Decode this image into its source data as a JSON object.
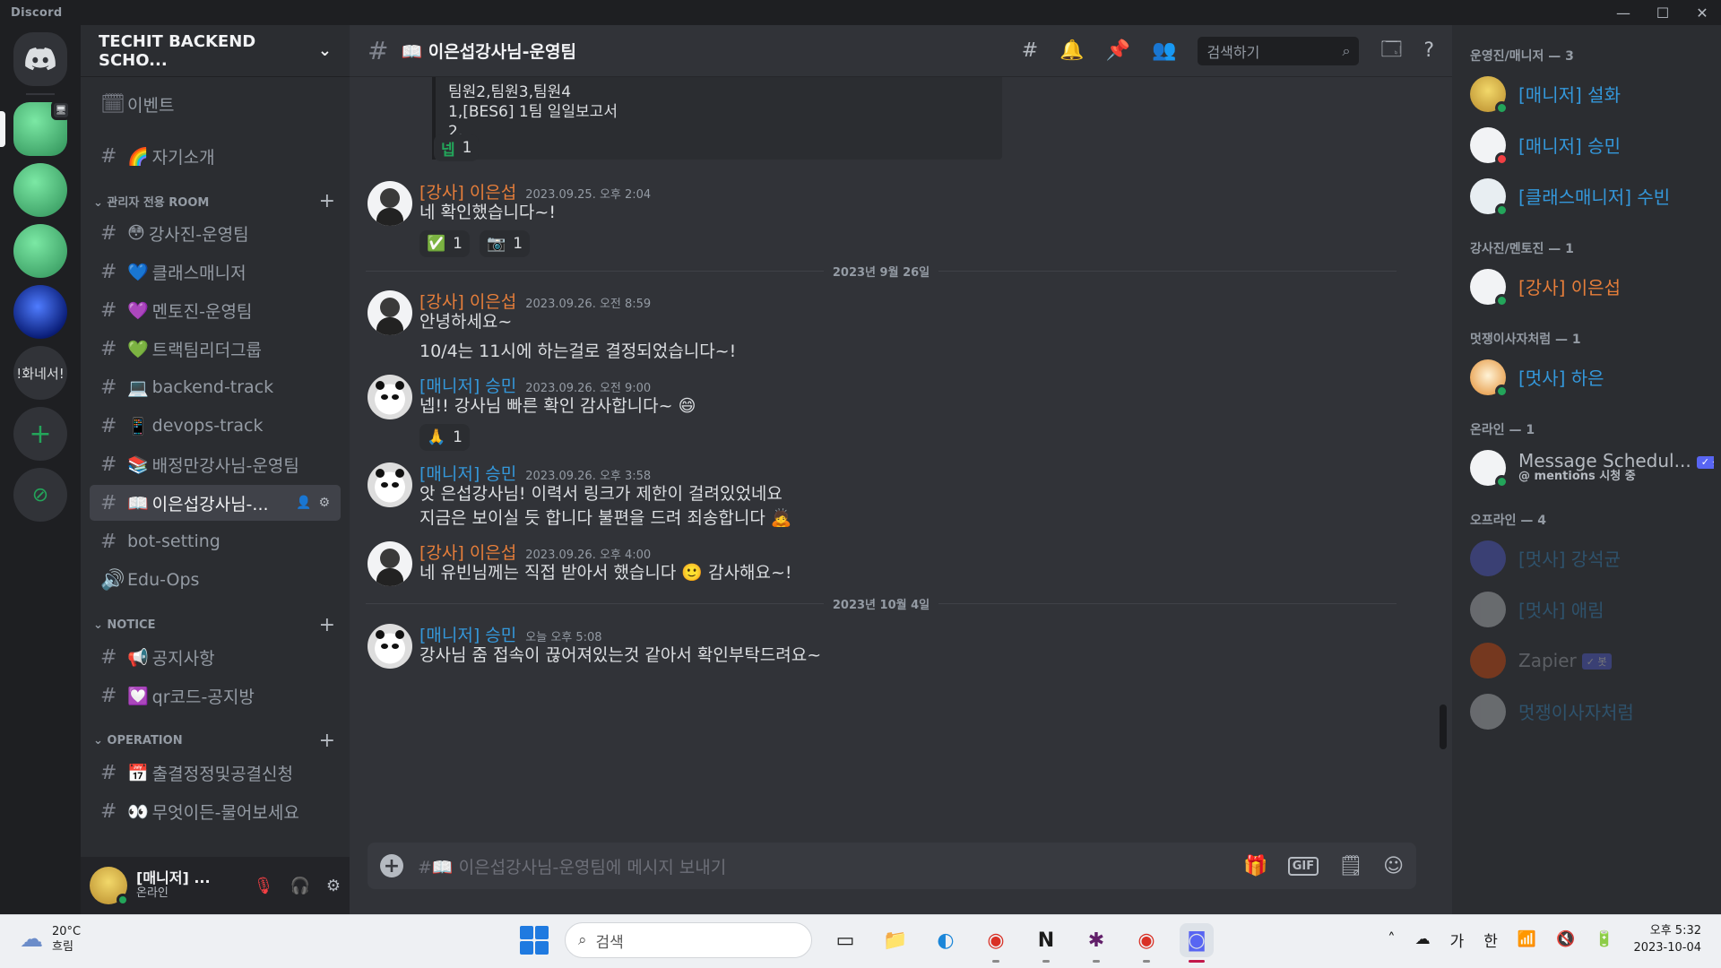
{
  "window": {
    "app_name": "Discord",
    "controls": [
      "—",
      "☐",
      "✕"
    ]
  },
  "servers": [
    {
      "label": "Discord",
      "kind": "home"
    },
    {
      "label": "",
      "kind": "green",
      "active": true,
      "badge": "🖥"
    },
    {
      "label": "",
      "kind": "green"
    },
    {
      "label": "",
      "kind": "green"
    },
    {
      "label": "",
      "kind": "blue"
    },
    {
      "label": "!화네서!"
    },
    {
      "label": "+",
      "kind": "plus"
    },
    {
      "label": "⊘",
      "kind": "compass"
    }
  ],
  "guild": {
    "name": "TECHIT BACKEND SCHO...",
    "chevron": "⌄"
  },
  "sidebar": {
    "events_label": "이벤트",
    "intro_channel": {
      "emoji": "🌈",
      "name": "자기소개"
    },
    "categories": [
      {
        "name": "관리자 전용 ROOM",
        "channels": [
          {
            "emoji": "😳",
            "name": "강사진-운영팀"
          },
          {
            "emoji": "💙",
            "name": "클래스매니저"
          },
          {
            "emoji": "💜",
            "name": "멘토진-운영팀"
          },
          {
            "emoji": "💚",
            "name": "트랙팀리더그룹"
          },
          {
            "emoji": "💻",
            "name": "backend-track"
          },
          {
            "emoji": "📱",
            "name": "devops-track"
          },
          {
            "emoji": "📚",
            "name": "배정만강사님-운영팀"
          },
          {
            "emoji": "📖",
            "name": "이은섭강사님-...",
            "active": true
          },
          {
            "emoji": "",
            "name": "bot-setting"
          },
          {
            "emoji": "",
            "name": "Edu-Ops",
            "voice": true
          }
        ]
      },
      {
        "name": "NOTICE",
        "channels": [
          {
            "emoji": "📢",
            "name": "공지사항"
          },
          {
            "emoji": "💟",
            "name": "qr코드-공지방"
          }
        ]
      },
      {
        "name": "OPERATION",
        "channels": [
          {
            "emoji": "📅",
            "name": "출결정정및공결신청"
          },
          {
            "emoji": "👀",
            "name": "무엇이든-물어보세요"
          }
        ]
      }
    ]
  },
  "user_panel": {
    "name": "[매니저] ...",
    "status": "온라인"
  },
  "header": {
    "channel_title": "📖 이은섭강사님-운영팀",
    "search_placeholder": "검색하기"
  },
  "embed": {
    "lines": [
      "팀원2,팀원3,팀원4",
      "1,[BES6] 1팀 일일보고서",
      "2,"
    ]
  },
  "embed_reactions": [
    {
      "emoji": "넵",
      "count": "1"
    }
  ],
  "messages": [
    {
      "author": "[강사] 이은섭",
      "role": "lecturer",
      "time": "2023.09.25. 오후 2:04",
      "lines": [
        "네 확인했습니다~!"
      ],
      "reactions": [
        {
          "emoji": "✅",
          "count": "1"
        },
        {
          "emoji": "📷",
          "count": "1"
        }
      ]
    },
    {
      "author": "[강사] 이은섭",
      "role": "lecturer",
      "time": "2023.09.26. 오전 8:59",
      "lines": [
        "안녕하세요~",
        "10/4는 11시에 하는걸로 결정되었습니다~!"
      ],
      "reactions": []
    },
    {
      "author": "[매니저] 승민",
      "role": "manager",
      "time": "2023.09.26. 오전 9:00",
      "lines": [
        "넵!! 강사님 빠른 확인 감사합니다~ 😄"
      ],
      "reactions": [
        {
          "emoji": "🙏",
          "count": "1"
        }
      ]
    },
    {
      "author": "[매니저] 승민",
      "role": "manager",
      "time": "2023.09.26. 오후 3:58",
      "lines": [
        "앗 은섭강사님! 이력서 링크가 제한이 걸려있었네요",
        "지금은 보이실 듯 합니다 불편을 드려 죄송합니다 🙇"
      ],
      "reactions": []
    },
    {
      "author": "[강사] 이은섭",
      "role": "lecturer",
      "time": "2023.09.26. 오후 4:00",
      "lines": [
        "네 유빈님께는 직접 받아서 했습니다 🙂 감사해요~!"
      ],
      "reactions": []
    },
    {
      "author": "[매니저] 승민",
      "role": "manager",
      "time": "오늘 오후 5:08",
      "lines": [
        "강사님 줌 접속이 끊어져있는것 같아서 확인부탁드려요~"
      ],
      "reactions": []
    }
  ],
  "dividers": [
    "2023년 9월 26일",
    "2023년 10월 4일"
  ],
  "composer": {
    "placeholder": "#📖 이은섭강사님-운영팀에 메시지 보내기",
    "gif": "GIF"
  },
  "members": {
    "groups": [
      {
        "title": "운영진/매니저 — 3",
        "items": [
          {
            "name": "[매니저] 설화",
            "color": "#3498db",
            "status": "#23a55a"
          },
          {
            "name": "[매니저] 승민",
            "color": "#3498db",
            "status": "#f23f43"
          },
          {
            "name": "[클래스매니저] 수빈",
            "color": "#3498db",
            "status": "#23a55a"
          }
        ]
      },
      {
        "title": "강사진/멘토진 — 1",
        "items": [
          {
            "name": "[강사] 이은섭",
            "color": "#e67e3a",
            "status": "#23a55a"
          }
        ]
      },
      {
        "title": "멋쟁이사자처럼 — 1",
        "items": [
          {
            "name": "[멋사] 하은",
            "color": "#3498db",
            "status": "#23a55a"
          }
        ]
      },
      {
        "title": "온라인 — 1",
        "items": [
          {
            "name": "Message Schedul...",
            "color": "#b5bac1",
            "status": "#23a55a",
            "bot": "✓ 봇",
            "sub": "@ mentions 시청 중"
          }
        ]
      },
      {
        "title": "오프라인 — 4",
        "items": [
          {
            "name": "[멋사] 강석균",
            "color": "#3498db",
            "offline": true
          },
          {
            "name": "[멋사] 애림",
            "color": "#3498db",
            "offline": true
          },
          {
            "name": "Zapier",
            "color": "#b5bac1",
            "offline": true,
            "bot": "✓ 봇"
          },
          {
            "name": "멋쟁이사자처럼",
            "color": "#3498db",
            "offline": true
          }
        ]
      }
    ]
  },
  "taskbar": {
    "temp": "20°C",
    "weather": "흐림",
    "search": "검색",
    "ime_1": "가",
    "ime_2": "한",
    "time": "오후 5:32",
    "date": "2023-10-04"
  }
}
